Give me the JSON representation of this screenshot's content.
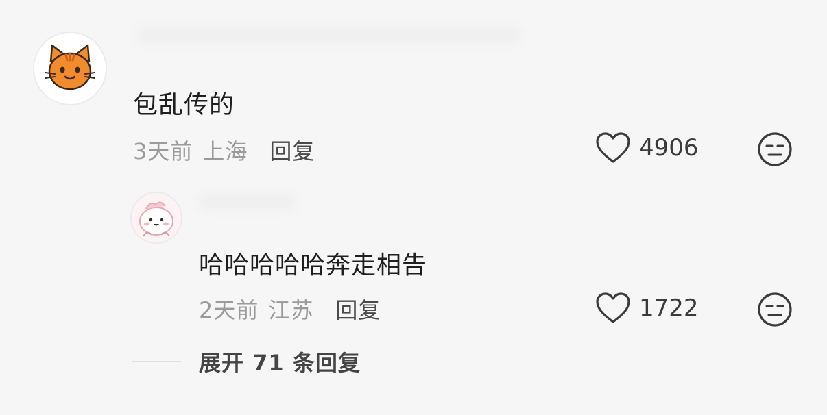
{
  "comments": [
    {
      "avatar_icon": "cat-face-icon",
      "text": "包乱传的",
      "time": "3天前",
      "location": "上海",
      "reply_label": "回复",
      "likes": "4906",
      "dislike_icon": "unamused-face-icon"
    }
  ],
  "replies": [
    {
      "avatar_icon": "cute-character-icon",
      "text": "哈哈哈哈哈奔走相告",
      "time": "2天前",
      "location": "江苏",
      "reply_label": "回复",
      "likes": "1722",
      "dislike_icon": "unamused-face-icon"
    }
  ],
  "expand": {
    "label": "展开 71 条回复"
  },
  "colors": {
    "background": "#f6f6f6",
    "cat_orange": "#f28b2c",
    "muted_text": "#9a9a9a"
  }
}
